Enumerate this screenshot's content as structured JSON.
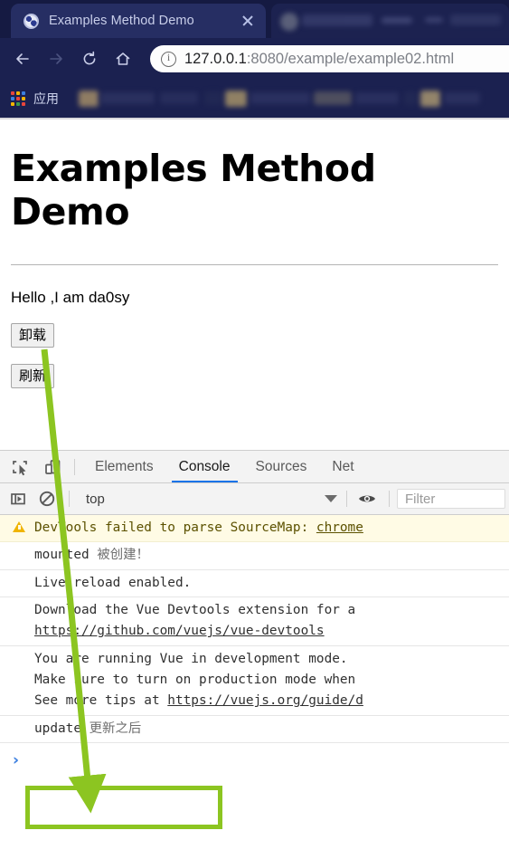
{
  "browser": {
    "tab": {
      "title": "Examples Method Demo",
      "favicon": "globe-icon",
      "close": "×"
    },
    "second_tab_title": "",
    "nav": {
      "back": "back-arrow-icon",
      "forward": "forward-arrow-icon",
      "reload": "reload-icon",
      "home": "home-icon"
    },
    "omnibox": {
      "security_icon": "info-circle-icon",
      "url_host": "127.0.0.1",
      "url_rest": ":8080/example/example02.html"
    },
    "bookmarks": {
      "apps_label": "应用"
    }
  },
  "page": {
    "title": "Examples Method Demo",
    "paragraph": "Hello ,I am da0sy",
    "buttons": [
      {
        "label": "卸载",
        "name": "unmount-button"
      },
      {
        "label": "刷新",
        "name": "refresh-button"
      }
    ]
  },
  "devtools": {
    "toolbar_icons": {
      "inspect": "inspect-element-icon",
      "device": "device-toolbar-icon",
      "sidebar": "console-sidebar-icon",
      "clear": "clear-console-icon",
      "eye": "eye-icon",
      "caret": "chevron-down-icon"
    },
    "tabs": [
      {
        "label": "Elements",
        "active": false
      },
      {
        "label": "Console",
        "active": true
      },
      {
        "label": "Sources",
        "active": false
      },
      {
        "label": "Net",
        "active": false
      }
    ],
    "context": "top",
    "filter_placeholder": "Filter",
    "console_rows": [
      {
        "type": "warning",
        "text": "DevTools failed to parse SourceMap: ",
        "link": "chrome"
      },
      {
        "type": "log",
        "text": "mounted ",
        "cn": "被创建！"
      },
      {
        "type": "log",
        "text": "Live reload enabled."
      },
      {
        "type": "log",
        "text": "Download the Vue Devtools extension for a",
        "link": "https://github.com/vuejs/vue-devtools"
      },
      {
        "type": "log",
        "line1": "You are running Vue in development mode.",
        "line2": "Make sure to turn on production mode when",
        "line3_pre": "See more tips at ",
        "line3_link": "https://vuejs.org/guide/d"
      },
      {
        "type": "log",
        "text": "update ",
        "cn": "更新之后",
        "highlighted": true
      }
    ],
    "prompt": "›"
  },
  "annotations": {
    "arrow_color": "#8cc521",
    "highlight_color": "#8cc521"
  },
  "colors": {
    "chrome_bg": "#1b2150",
    "tab_active_bg": "#262e63",
    "devtools_accent": "#1a73e8",
    "warn_bg": "#fffbe5",
    "annotation_green": "#8cc521"
  }
}
